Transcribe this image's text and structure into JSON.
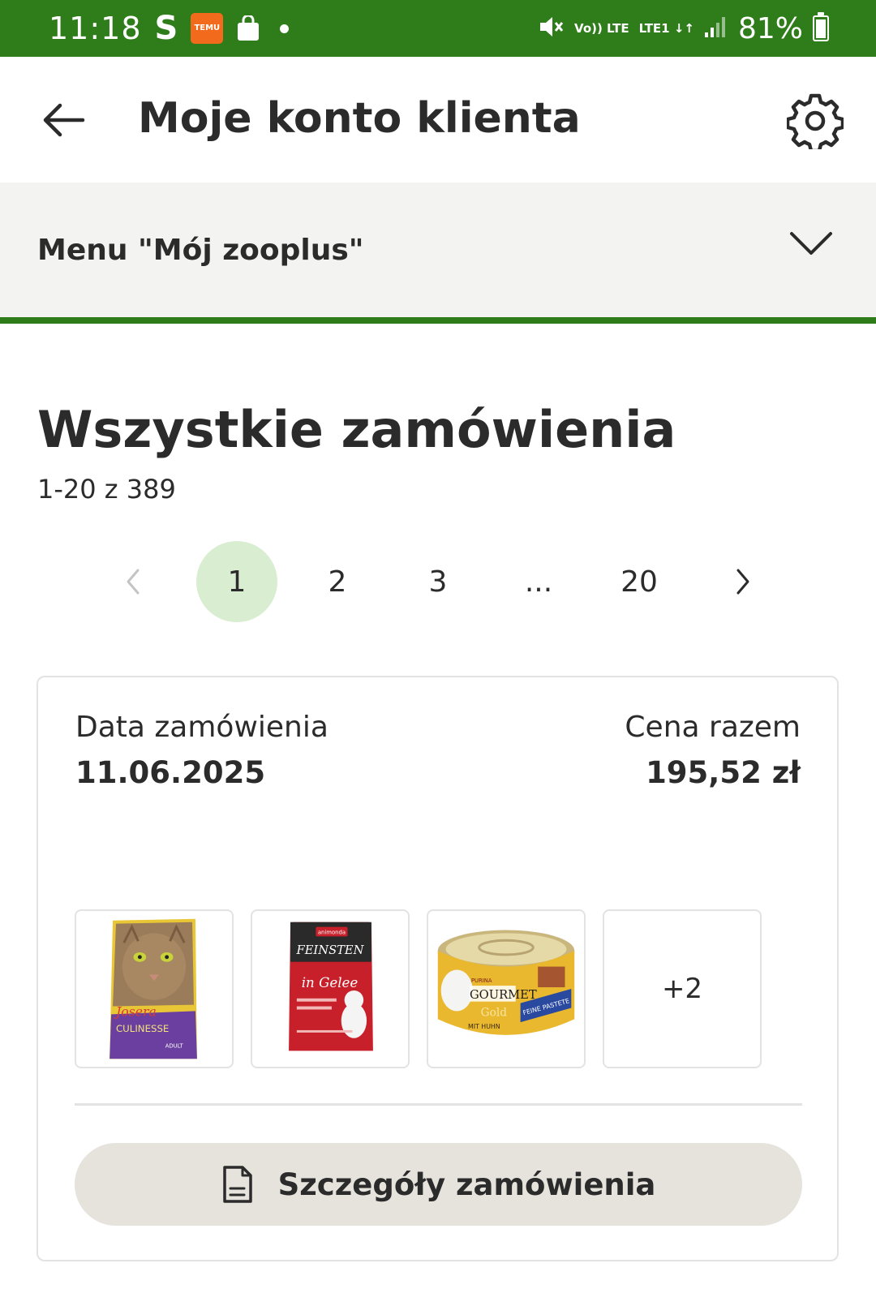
{
  "status_bar": {
    "time": "11:18",
    "s_indicator": "S",
    "temu_label": "TEMU",
    "net_top": "Vo)) LTE",
    "net_bottom": "LTE1 ↓↑",
    "battery": "81%",
    "battery_level": 0.81
  },
  "header": {
    "title": "Moje konto klienta",
    "back_icon": "arrow-left-icon",
    "settings_icon": "gear-icon"
  },
  "menu": {
    "label": "Menu \"Mój zooplus\"",
    "icon": "chevron-down-icon"
  },
  "orders": {
    "title": "Wszystkie zamówienia",
    "count_text": "1-20 z 389"
  },
  "pagination": {
    "pages": [
      "1",
      "2",
      "3",
      "...",
      "20"
    ],
    "active": "1"
  },
  "order": {
    "date_label": "Data zamówienia",
    "date": "11.06.2025",
    "total_label": "Cena razem",
    "total": "195,52 zł",
    "products": [
      {
        "brand": "Josera",
        "name": "CULINESSE",
        "tag": "ADULT"
      },
      {
        "brand": "animonda",
        "name": "FEINSTEN",
        "tag": "in Gelee"
      },
      {
        "brand": "PURINA",
        "name": "GOURMET",
        "tag": "Gold",
        "extra": "FEINE PASTETE",
        "extra2": "MIT HUHN"
      }
    ],
    "more_items": "+2",
    "details_button": "Szczegóły zamówienia"
  },
  "colors": {
    "brand_green": "#2f7d1a",
    "active_page_bg": "#d9edd0",
    "button_bg": "#e6e3dc"
  }
}
